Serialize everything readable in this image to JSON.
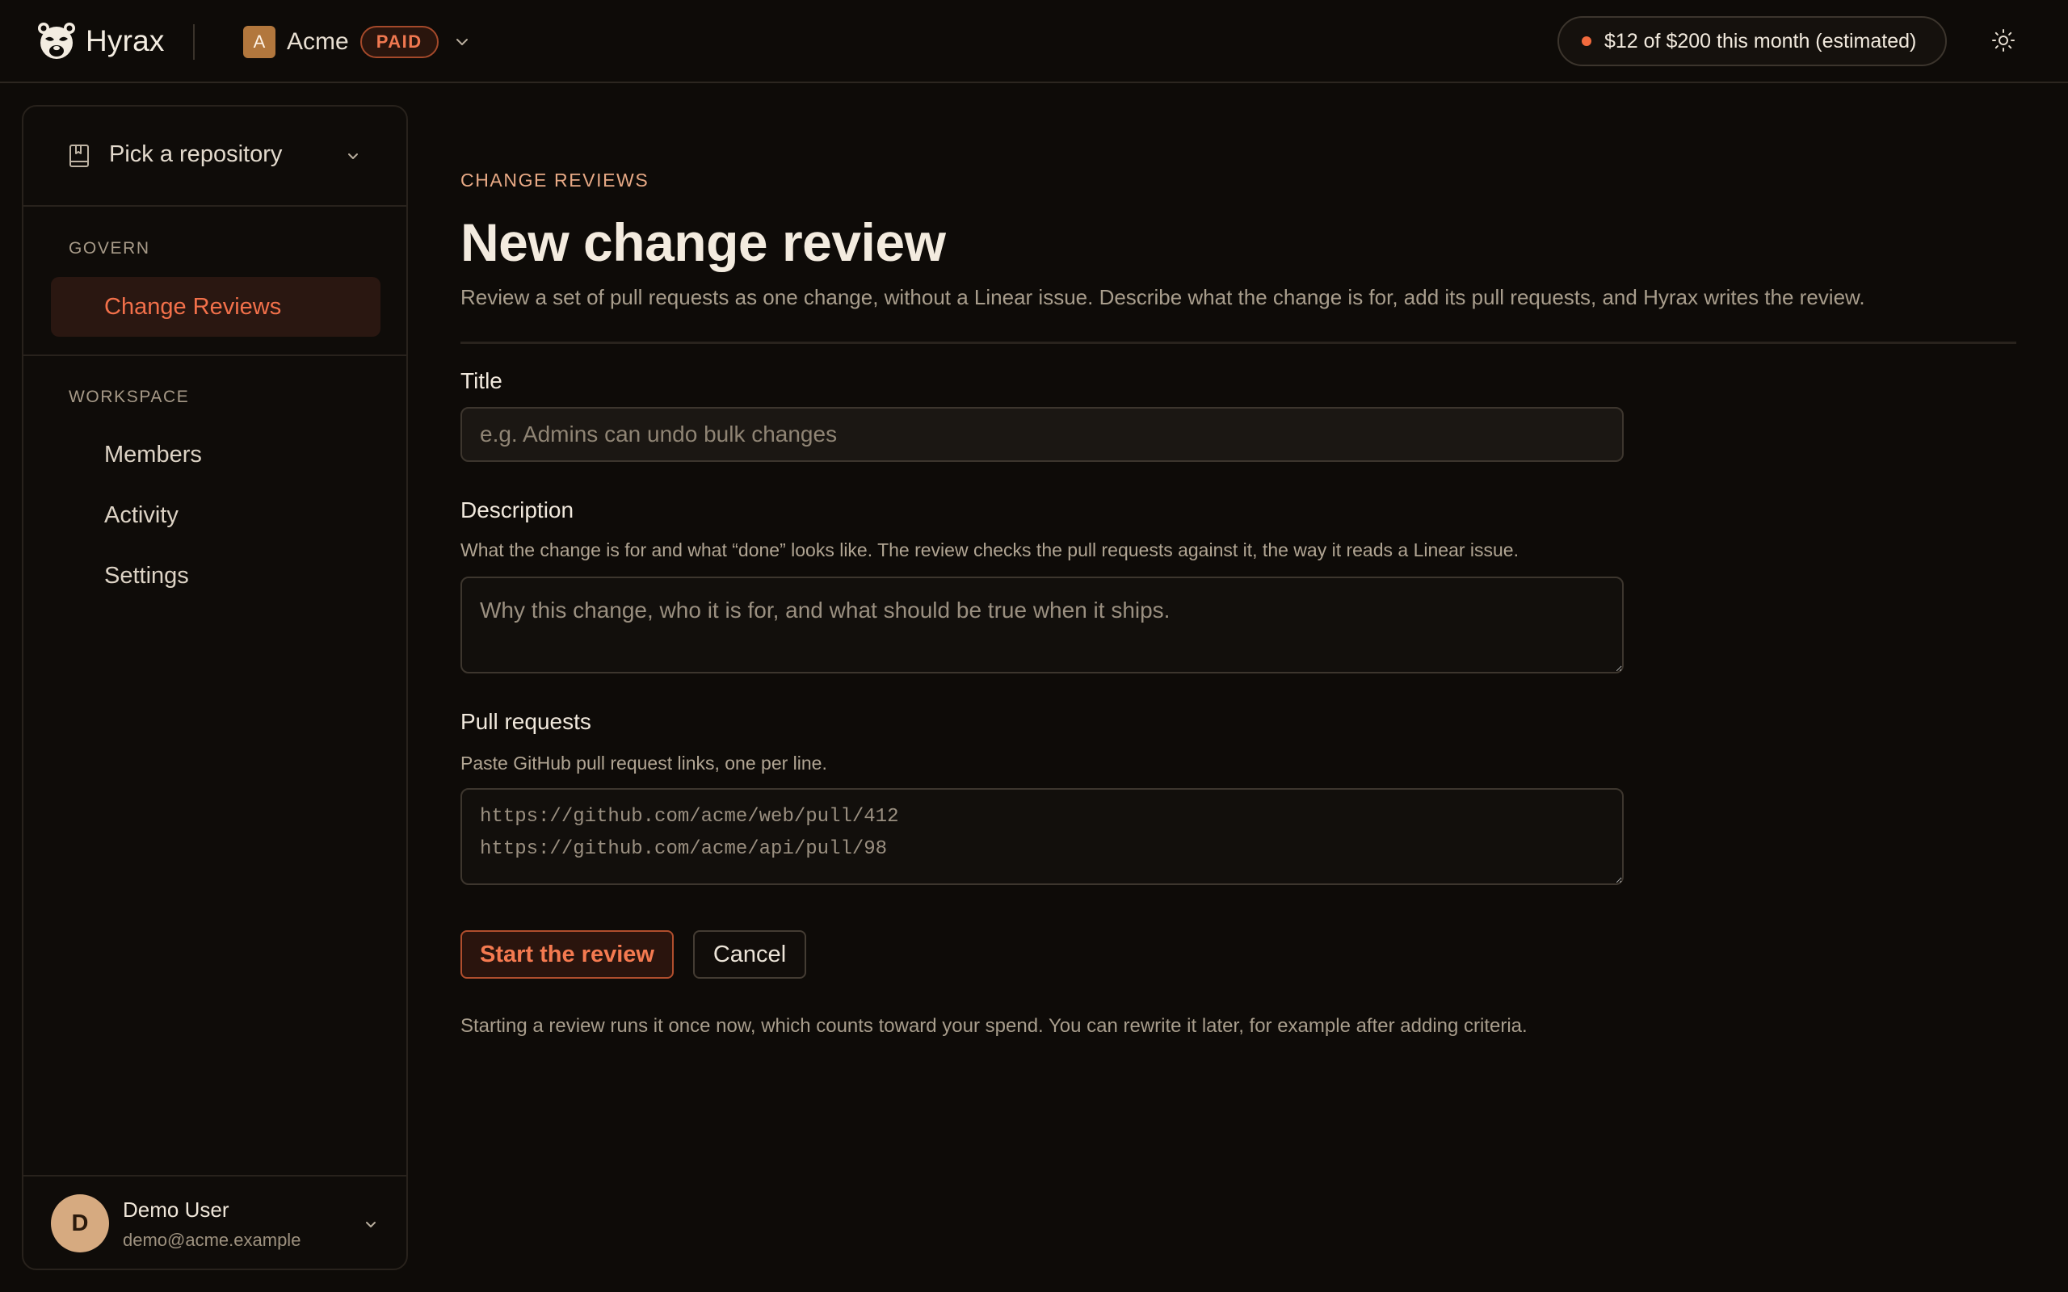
{
  "header": {
    "brand_name": "Hyrax",
    "org_initial": "A",
    "org_name": "Acme",
    "org_plan_badge": "PAID",
    "spend_text": "$12 of $200 this month (estimated)",
    "accent_color": "#f26a3d"
  },
  "sidebar": {
    "repo_picker_label": "Pick a repository",
    "sections": [
      {
        "label": "GOVERN",
        "items": [
          {
            "label": "Change Reviews",
            "active": true
          }
        ]
      },
      {
        "label": "WORKSPACE",
        "items": [
          {
            "label": "Members"
          },
          {
            "label": "Activity"
          },
          {
            "label": "Settings"
          }
        ]
      }
    ],
    "user": {
      "initial": "D",
      "name": "Demo User",
      "email": "demo@acme.example"
    }
  },
  "main": {
    "eyebrow": "CHANGE REVIEWS",
    "title": "New change review",
    "subtitle": "Review a set of pull requests as one change, without a Linear issue. Describe what the change is for, add its pull requests, and Hyrax writes the review.",
    "form": {
      "title_label": "Title",
      "title_placeholder": "e.g. Admins can undo bulk changes",
      "description_label": "Description",
      "description_help": "What the change is for and what “done” looks like. The review checks the pull requests against it, the way it reads a Linear issue.",
      "description_placeholder": "Why this change, who it is for, and what should be true when it ships.",
      "prs_label": "Pull requests",
      "prs_help": "Paste GitHub pull request links, one per line.",
      "prs_placeholder": "https://github.com/acme/web/pull/412\nhttps://github.com/acme/api/pull/98",
      "submit_label": "Start the review",
      "cancel_label": "Cancel",
      "footnote": "Starting a review runs it once now, which counts toward your spend. You can rewrite it later, for example after adding criteria."
    }
  }
}
